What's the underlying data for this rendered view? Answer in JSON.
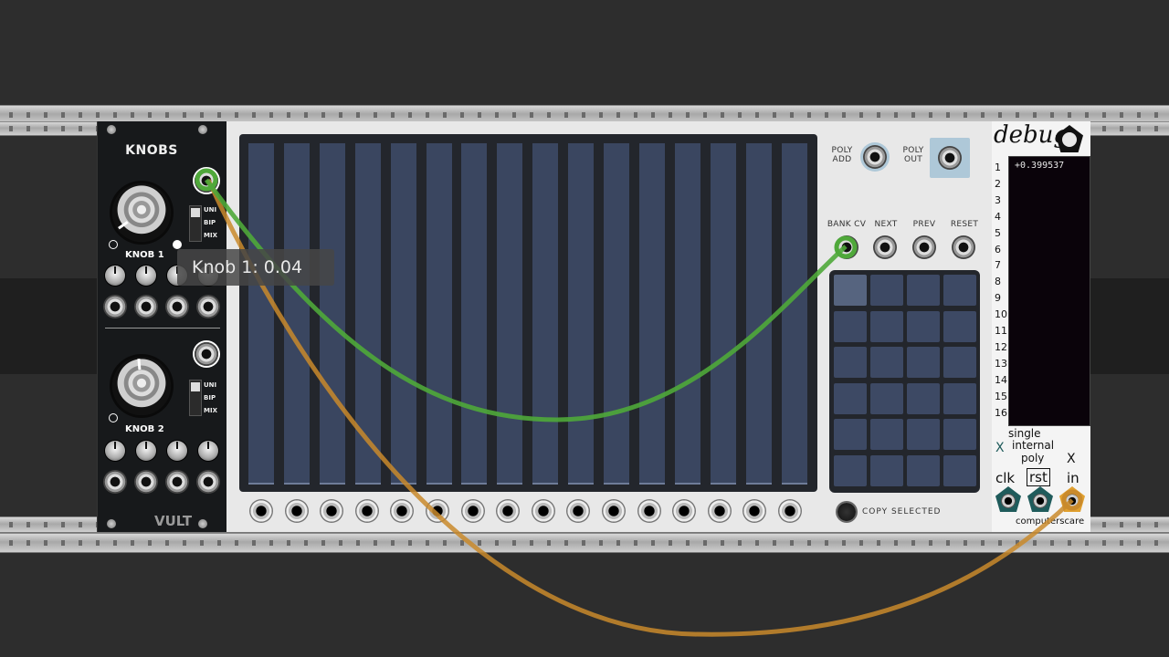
{
  "knobs_module": {
    "title": "KNOBS",
    "knob1_label": "KNOB 1",
    "knob2_label": "KNOB 2",
    "switch_options": [
      "UNI",
      "BIP",
      "MIX"
    ],
    "brand": "VULT"
  },
  "tooltip": {
    "text": "Knob 1: 0.04"
  },
  "sequencer": {
    "poly_add": [
      "POLY",
      "ADD"
    ],
    "poly_out": [
      "POLY",
      "OUT"
    ],
    "bank_cv": "BANK CV",
    "next": "NEXT",
    "prev": "PREV",
    "reset": "RESET",
    "copy_selected": "COPY SELECTED"
  },
  "debug_module": {
    "title": "debug",
    "value": "+0.399537",
    "channels": [
      "1",
      "2",
      "3",
      "4",
      "5",
      "6",
      "7",
      "8",
      "9",
      "10",
      "11",
      "12",
      "13",
      "14",
      "15",
      "16"
    ],
    "mode_single": "single",
    "mode_internal": "internal",
    "mode_poly": "poly",
    "clk": "clk",
    "rst": "rst",
    "in": "in",
    "brand": "computerscare"
  },
  "colors": {
    "cable_green": "#4fa83a",
    "cable_orange": "#c98a2c",
    "panel_dark": "#17191b"
  }
}
